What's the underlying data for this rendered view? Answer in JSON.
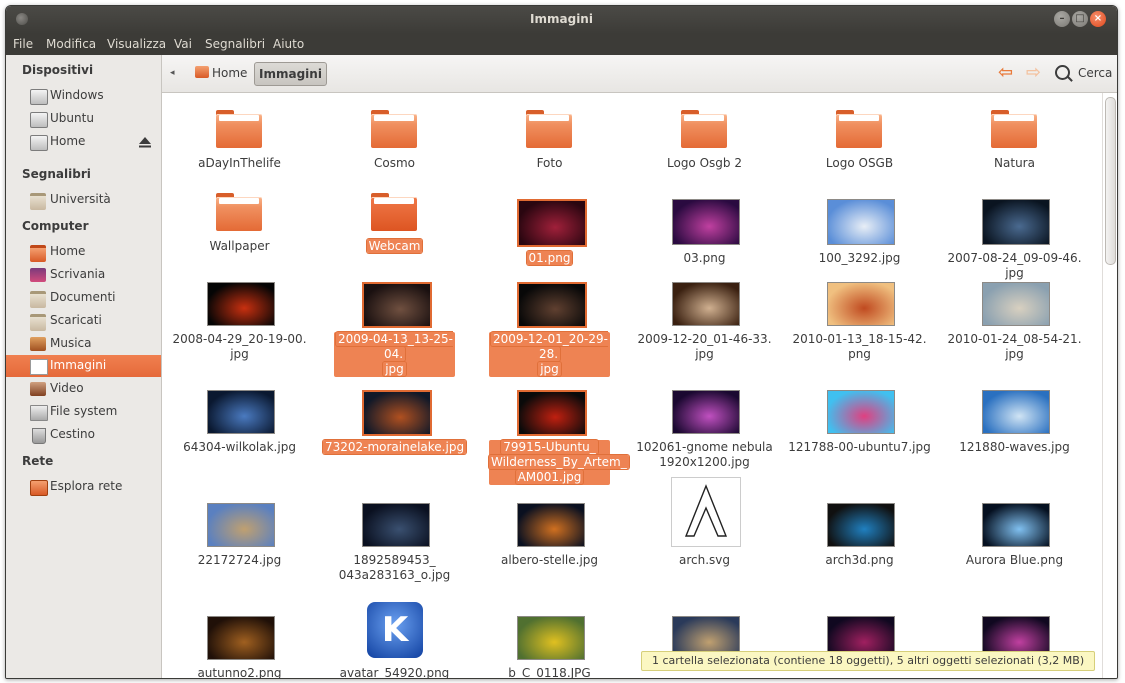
{
  "window": {
    "title": "Immagini"
  },
  "menubar": {
    "items": [
      "File",
      "Modifica",
      "Visualizza",
      "Vai",
      "Segnalibri",
      "Aiuto"
    ]
  },
  "sidebar": {
    "sections": [
      {
        "title": "Dispositivi",
        "items": [
          {
            "label": "Windows",
            "icon": "drive-icon"
          },
          {
            "label": "Ubuntu",
            "icon": "drive-icon"
          },
          {
            "label": "Home",
            "icon": "drive-icon",
            "eject": true
          }
        ]
      },
      {
        "title": "Segnalibri",
        "items": [
          {
            "label": "Università",
            "icon": "folder-icon"
          }
        ]
      },
      {
        "title": "Computer",
        "items": [
          {
            "label": "Home",
            "icon": "home-folder-icon"
          },
          {
            "label": "Scrivania",
            "icon": "desktop-icon"
          },
          {
            "label": "Documenti",
            "icon": "documents-icon"
          },
          {
            "label": "Scaricati",
            "icon": "downloads-icon"
          },
          {
            "label": "Musica",
            "icon": "music-icon"
          },
          {
            "label": "Immagini",
            "icon": "pictures-icon",
            "active": true
          },
          {
            "label": "Video",
            "icon": "video-icon"
          },
          {
            "label": "File system",
            "icon": "filesystem-icon"
          },
          {
            "label": "Cestino",
            "icon": "trash-icon"
          }
        ]
      },
      {
        "title": "Rete",
        "items": [
          {
            "label": "Esplora rete",
            "icon": "network-icon"
          }
        ]
      }
    ]
  },
  "toolbar": {
    "breadcrumbs": [
      "Home",
      "Immagini"
    ],
    "search_label": "Cerca"
  },
  "files": [
    {
      "name": "aDayInThelife",
      "type": "folder"
    },
    {
      "name": "Cosmo",
      "type": "folder"
    },
    {
      "name": "Foto",
      "type": "folder"
    },
    {
      "name": "Logo Osgb 2",
      "type": "folder"
    },
    {
      "name": "Logo OSGB",
      "type": "folder"
    },
    {
      "name": "Natura",
      "type": "folder"
    },
    {
      "name": "Wallpaper",
      "type": "folder"
    },
    {
      "name": "Webcam",
      "type": "folder",
      "selected": true
    },
    {
      "name": "01.png",
      "type": "image",
      "colors": [
        "#2a0610",
        "#a0203a"
      ],
      "selected": true
    },
    {
      "name": "03.png",
      "type": "image",
      "colors": [
        "#2a0a40",
        "#c040a0"
      ]
    },
    {
      "name": "100_3292.jpg",
      "type": "image",
      "colors": [
        "#5a8ed8",
        "#e8eef6"
      ]
    },
    {
      "name": "2007-08-24_09-09-46.\njpg",
      "type": "image",
      "colors": [
        "#0a1420",
        "#4a6a90"
      ]
    },
    {
      "name": "2008-04-29_20-19-00.\njpg",
      "type": "image",
      "colors": [
        "#050505",
        "#c83010"
      ]
    },
    {
      "name": "2009-04-13_13-25-04.\njpg",
      "type": "image",
      "colors": [
        "#1a1010",
        "#705040"
      ],
      "selected": true
    },
    {
      "name": "2009-12-01_20-29-28.\njpg",
      "type": "image",
      "colors": [
        "#080808",
        "#604030"
      ],
      "selected": true
    },
    {
      "name": "2009-12-20_01-46-33.\njpg",
      "type": "image",
      "colors": [
        "#3a2010",
        "#d0b090"
      ]
    },
    {
      "name": "2010-01-13_18-15-42.\npng",
      "type": "image",
      "colors": [
        "#f0c080",
        "#c04a20"
      ]
    },
    {
      "name": "2010-01-24_08-54-21.\njpg",
      "type": "image",
      "colors": [
        "#8aa0b0",
        "#d8d0c0"
      ]
    },
    {
      "name": "64304-wilkolak.jpg",
      "type": "image",
      "colors": [
        "#0a1830",
        "#4a7ac0"
      ]
    },
    {
      "name": "73202-morainelake.jpg",
      "type": "image",
      "colors": [
        "#101828",
        "#b05020"
      ],
      "selected": true
    },
    {
      "name": "79915-Ubuntu_\nWilderness_By_Artem_\nAM001.jpg",
      "type": "image",
      "colors": [
        "#0a0a0a",
        "#c02010"
      ],
      "selected": true
    },
    {
      "name": "102061-gnome nebula\n1920x1200.jpg",
      "type": "image",
      "colors": [
        "#1a0830",
        "#c050c0"
      ]
    },
    {
      "name": "121788-00-ubuntu7.jpg",
      "type": "image",
      "colors": [
        "#40c0f0",
        "#e04080"
      ]
    },
    {
      "name": "121880-waves.jpg",
      "type": "image",
      "colors": [
        "#2a70c0",
        "#d0e4f4"
      ]
    },
    {
      "name": "22172724.jpg",
      "type": "image",
      "colors": [
        "#5a80c0",
        "#c0a070"
      ]
    },
    {
      "name": "1892589453_\n043a283163_o.jpg",
      "type": "image",
      "colors": [
        "#0a1020",
        "#3a5070"
      ]
    },
    {
      "name": "albero-stelle.jpg",
      "type": "image",
      "colors": [
        "#0a1020",
        "#d07020"
      ]
    },
    {
      "name": "arch.svg",
      "type": "image",
      "colors": [
        "#ffffff",
        "#ffffff"
      ]
    },
    {
      "name": "arch3d.png",
      "type": "image",
      "colors": [
        "#101010",
        "#2080c0"
      ]
    },
    {
      "name": "Aurora Blue.png",
      "type": "image",
      "colors": [
        "#051020",
        "#80c0f0"
      ]
    },
    {
      "name": "autunno2.png",
      "type": "image",
      "colors": [
        "#201008",
        "#a06020"
      ]
    },
    {
      "name": "avatar_54920.png",
      "type": "image",
      "colors": [
        "#1040a0",
        "#4a80e0"
      ]
    },
    {
      "name": "b_C_0118.JPG",
      "type": "image",
      "colors": [
        "#507030",
        "#e0c020"
      ]
    },
    {
      "name": "",
      "type": "image",
      "colors": [
        "#2a3a5a",
        "#c0a070"
      ]
    },
    {
      "name": "",
      "type": "image",
      "colors": [
        "#100820",
        "#a02060"
      ]
    },
    {
      "name": "",
      "type": "image",
      "colors": [
        "#100820",
        "#c040a0"
      ]
    }
  ],
  "statusbar": {
    "text": "1 cartella selezionata (contiene 18 oggetti), 5 altri oggetti selezionati (3,2 MB)"
  }
}
